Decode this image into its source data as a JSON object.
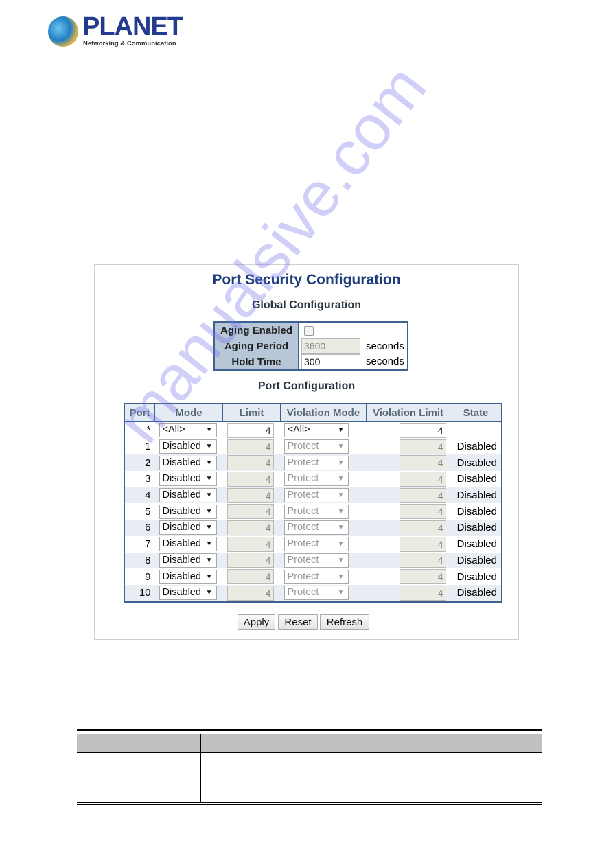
{
  "logo": {
    "brand": "PLANET",
    "tagline": "Networking & Communication"
  },
  "screen": {
    "title": "Port Security Configuration",
    "global": {
      "heading": "Global Configuration",
      "aging_enabled_label": "Aging Enabled",
      "aging_enabled": false,
      "aging_period_label": "Aging Period",
      "aging_period": "3600",
      "hold_time_label": "Hold Time",
      "hold_time": "300",
      "unit": "seconds"
    },
    "port": {
      "heading": "Port Configuration",
      "columns": [
        "Port",
        "Mode",
        "Limit",
        "Violation Mode",
        "Violation Limit",
        "State"
      ],
      "all_row": {
        "port": "*",
        "mode": "<All>",
        "limit": "4",
        "violation_mode": "<All>",
        "violation_limit": "4",
        "state": ""
      },
      "rows": [
        {
          "port": "1",
          "mode": "Disabled",
          "limit": "4",
          "violation_mode": "Protect",
          "violation_limit": "4",
          "state": "Disabled"
        },
        {
          "port": "2",
          "mode": "Disabled",
          "limit": "4",
          "violation_mode": "Protect",
          "violation_limit": "4",
          "state": "Disabled"
        },
        {
          "port": "3",
          "mode": "Disabled",
          "limit": "4",
          "violation_mode": "Protect",
          "violation_limit": "4",
          "state": "Disabled"
        },
        {
          "port": "4",
          "mode": "Disabled",
          "limit": "4",
          "violation_mode": "Protect",
          "violation_limit": "4",
          "state": "Disabled"
        },
        {
          "port": "5",
          "mode": "Disabled",
          "limit": "4",
          "violation_mode": "Protect",
          "violation_limit": "4",
          "state": "Disabled"
        },
        {
          "port": "6",
          "mode": "Disabled",
          "limit": "4",
          "violation_mode": "Protect",
          "violation_limit": "4",
          "state": "Disabled"
        },
        {
          "port": "7",
          "mode": "Disabled",
          "limit": "4",
          "violation_mode": "Protect",
          "violation_limit": "4",
          "state": "Disabled"
        },
        {
          "port": "8",
          "mode": "Disabled",
          "limit": "4",
          "violation_mode": "Protect",
          "violation_limit": "4",
          "state": "Disabled"
        },
        {
          "port": "9",
          "mode": "Disabled",
          "limit": "4",
          "violation_mode": "Protect",
          "violation_limit": "4",
          "state": "Disabled"
        },
        {
          "port": "10",
          "mode": "Disabled",
          "limit": "4",
          "violation_mode": "Protect",
          "violation_limit": "4",
          "state": "Disabled"
        }
      ]
    },
    "buttons": {
      "apply": "Apply",
      "reset": "Reset",
      "refresh": "Refresh"
    }
  },
  "watermark": "manualsive.com",
  "colors": {
    "title": "#1c3c7a",
    "table_border": "#3d6190",
    "header_bg": "#c0c0c0"
  }
}
